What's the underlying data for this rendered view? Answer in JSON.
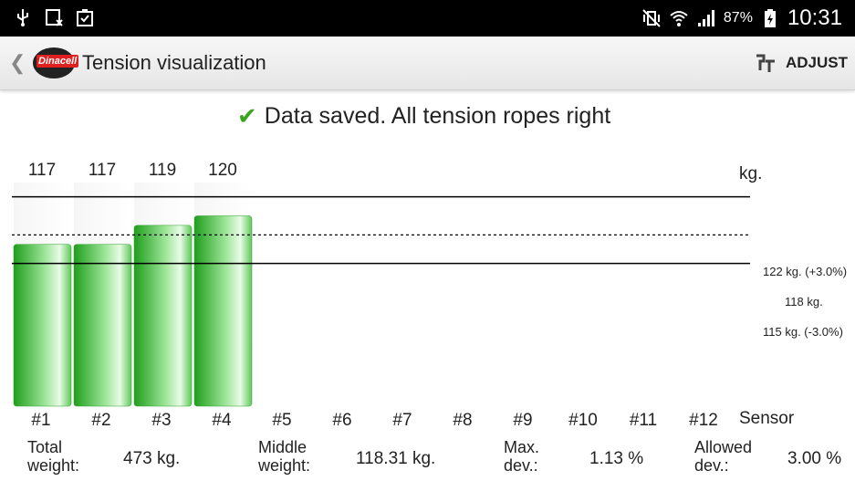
{
  "status_bar": {
    "battery": "87%",
    "time": "10:31"
  },
  "action_bar": {
    "logo_text": "Dinacell",
    "title": "Tension visualization",
    "adjust_label": "ADJUST"
  },
  "message": "Data saved. All tension ropes right",
  "chart_data": {
    "type": "bar",
    "categories": [
      "#1",
      "#2",
      "#3",
      "#4",
      "#5",
      "#6",
      "#7",
      "#8",
      "#9",
      "#10",
      "#11",
      "#12"
    ],
    "values": [
      117,
      117,
      119,
      120,
      null,
      null,
      null,
      null,
      null,
      null,
      null,
      null
    ],
    "value_labels": [
      "117",
      "117",
      "119",
      "120"
    ],
    "unit_label": "kg.",
    "xlabel": "Sensor",
    "ylim": [
      100,
      123.5
    ],
    "reference_lines": [
      {
        "value": 122,
        "label": "122 kg. (+3.0%)",
        "style": "solid"
      },
      {
        "value": 118,
        "label": "118 kg.",
        "style": "dashed"
      },
      {
        "value": 115,
        "label": "115 kg. (-3.0%)",
        "style": "solid"
      }
    ],
    "bar_color": "#2fb52a"
  },
  "stats": {
    "total_label": "Total weight:",
    "total_value": "473 kg.",
    "middle_label": "Middle weight:",
    "middle_value": "118.31 kg.",
    "max_label": "Max. dev.:",
    "max_value": "1.13 %",
    "allowed_label": "Allowed dev.:",
    "allowed_value": "3.00 %"
  }
}
